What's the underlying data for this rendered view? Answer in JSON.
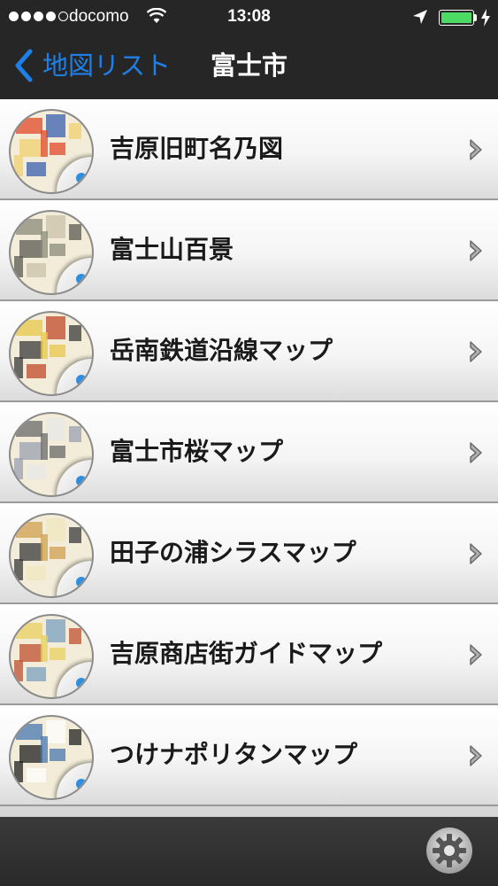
{
  "status": {
    "carrier": "docomo",
    "time": "13:08",
    "signal_bars_filled": 4,
    "signal_bars_total": 5,
    "battery_level": 1.0,
    "battery_color": "#4cd964"
  },
  "nav": {
    "back_label": "地図リスト",
    "title": "富士市",
    "accent_color": "#1e7fe6"
  },
  "maps": [
    {
      "label": "吉原旧町名乃図",
      "thumb_colors": [
        "#e04a2a",
        "#3a5fb0",
        "#f0d070"
      ]
    },
    {
      "label": "富士山百景",
      "thumb_colors": [
        "#8a8a7a",
        "#c9c2a8",
        "#5a5a50"
      ]
    },
    {
      "label": "岳南鉄道沿線マップ",
      "thumb_colors": [
        "#e8c84a",
        "#c04a2a",
        "#3a3a3a"
      ]
    },
    {
      "label": "富士市桜マップ",
      "thumb_colors": [
        "#6a6a6a",
        "#e8e8e8",
        "#9aa0b0"
      ]
    },
    {
      "label": "田子の浦シラスマップ",
      "thumb_colors": [
        "#d0a050",
        "#f0e8c0",
        "#3a3a3a"
      ]
    },
    {
      "label": "吉原商店街ガイドマップ",
      "thumb_colors": [
        "#e8d060",
        "#7aa0c0",
        "#c05030"
      ]
    },
    {
      "label": "つけナポリタンマップ",
      "thumb_colors": [
        "#4a78b0",
        "#ffffff",
        "#202020"
      ]
    }
  ],
  "toolbar": {
    "settings_icon": "gear-icon"
  }
}
